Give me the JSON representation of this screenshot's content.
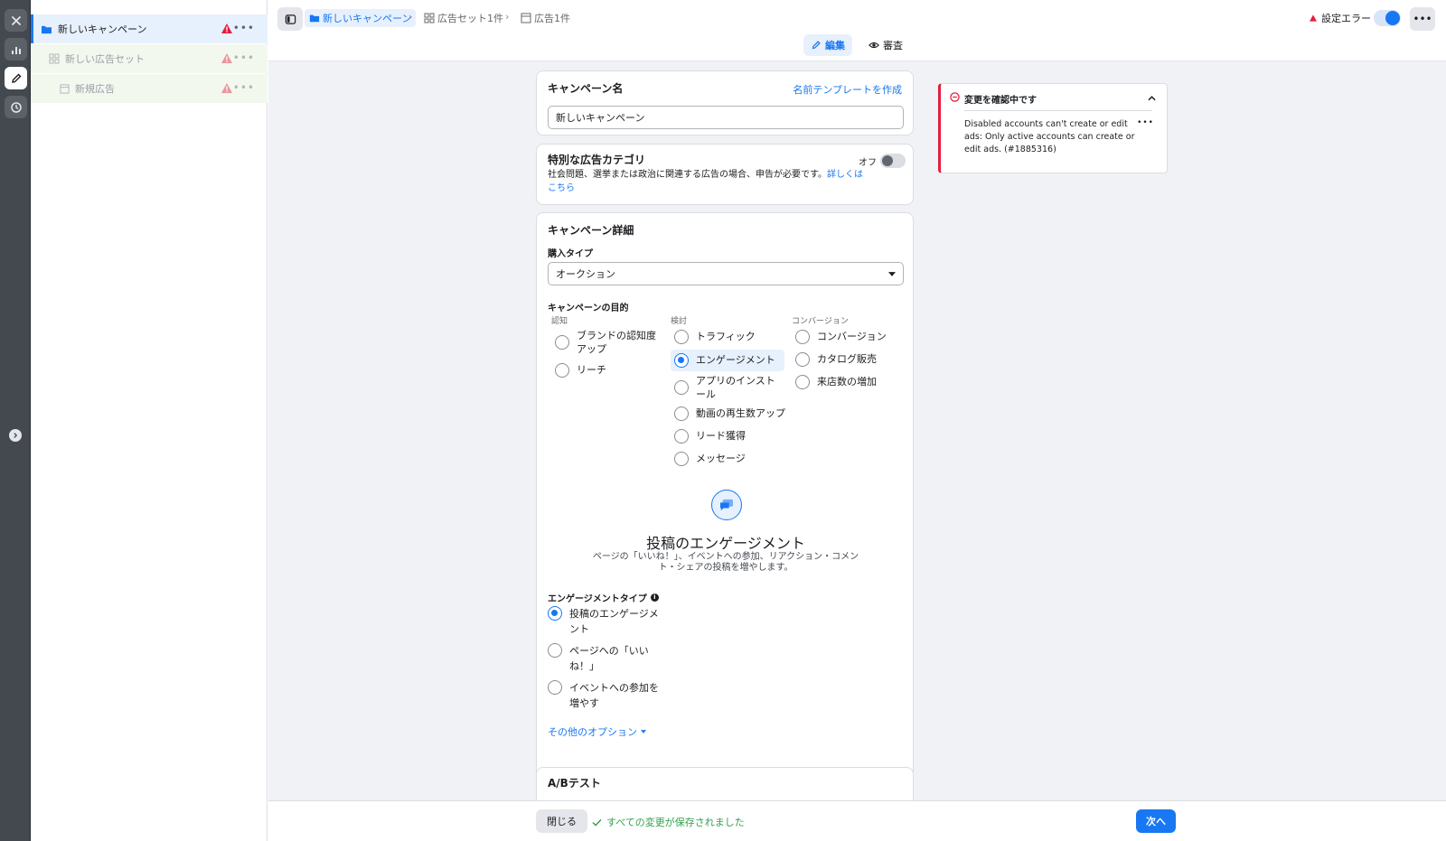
{
  "tree": {
    "items": [
      {
        "label": "新しいキャンペーン"
      },
      {
        "label": "新しい広告セット"
      },
      {
        "label": "新規広告"
      }
    ]
  },
  "breadcrumb": {
    "campaign": "新しいキャンペーン",
    "adset": "広告セット1件",
    "ad": "広告1件"
  },
  "modes": {
    "edit": "編集",
    "review": "審査"
  },
  "header": {
    "settings_error": "設定エラー"
  },
  "campaign_name": {
    "title": "キャンペーン名",
    "template_link": "名前テンプレートを作成",
    "value": "新しいキャンペーン"
  },
  "special_category": {
    "title": "特別な広告カテゴリ",
    "toggle_label": "オフ",
    "description": "社会問題、選挙または政治に関連する広告の場合、申告が必要です。",
    "link": "詳しくはこちら"
  },
  "details": {
    "title": "キャンペーン詳細",
    "buying_type_label": "購入タイプ",
    "buying_type_value": "オークション",
    "objective_label": "キャンペーンの目的",
    "groups": [
      {
        "label": "認知",
        "options": [
          "ブランドの認知度アップ",
          "リーチ"
        ]
      },
      {
        "label": "検討",
        "options": [
          "トラフィック",
          "エンゲージメント",
          "アプリのインストール",
          "動画の再生数アップ",
          "リード獲得",
          "メッセージ"
        ]
      },
      {
        "label": "コンバージョン",
        "options": [
          "コンバージョン",
          "カタログ販売",
          "来店数の増加"
        ]
      }
    ],
    "selected_objective": "エンゲージメント",
    "objective_heading": "投稿のエンゲージメント",
    "objective_description": "ページの「いいね！」、イベントへの参加、リアクション・コメント・シェアの投稿を増やします。",
    "engagement_type_label": "エンゲージメントタイプ",
    "engagement_types": [
      "投稿のエンゲージメント",
      "ページへの「いいね！」",
      "イベントへの参加を増やす"
    ],
    "selected_engagement_type": "投稿のエンゲージメント",
    "more_options": "その他のオプション"
  },
  "ab_test": {
    "title": "A/Bテスト"
  },
  "error_panel": {
    "title": "変更を確認中です",
    "message": "Disabled accounts can't create or edit ads: Only active accounts can create or edit ads. (#1885316)"
  },
  "footer": {
    "close": "閉じる",
    "saved": "すべての変更が保存されました",
    "next": "次へ"
  },
  "colors": {
    "accent": "#1877f2",
    "error": "#e41e3f",
    "success": "#31a24c"
  }
}
